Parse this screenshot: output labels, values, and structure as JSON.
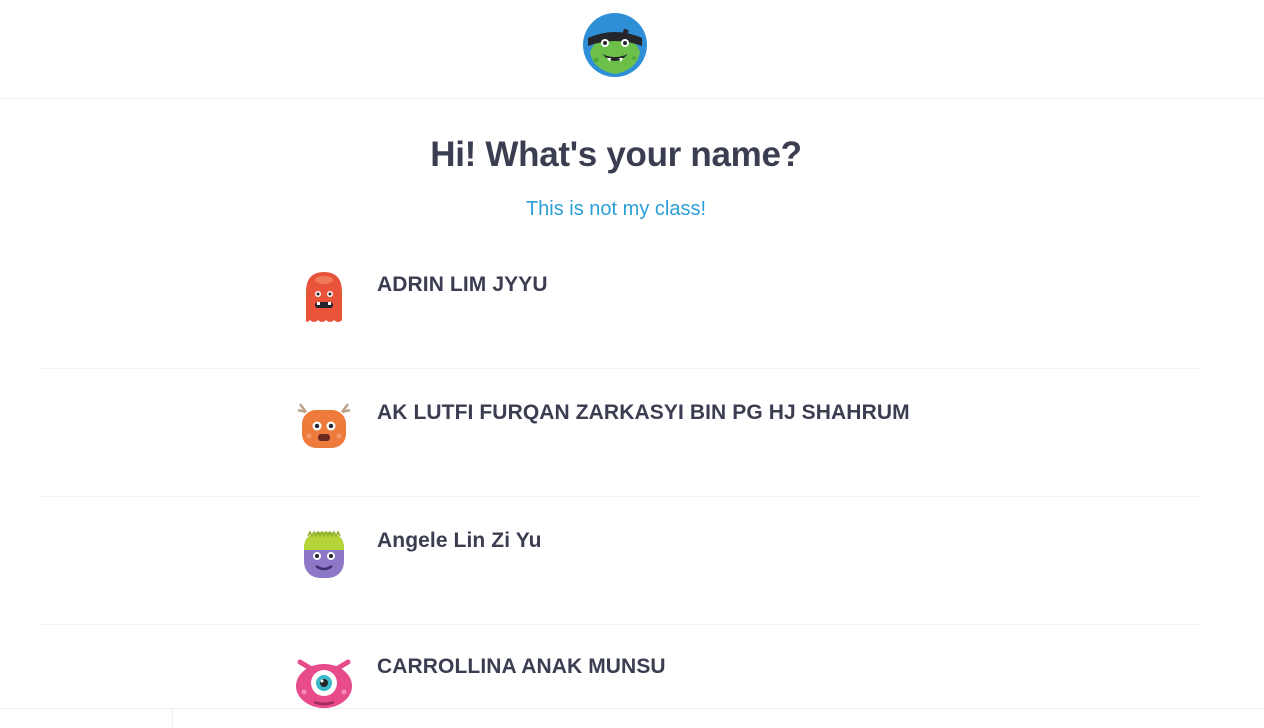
{
  "header": {
    "logo_icon": "classdojo-monster-logo-icon"
  },
  "main": {
    "title": "Hi! What's your name?",
    "not_my_class_link": "This is not my class!"
  },
  "students": [
    {
      "name": "ADRIN LIM JYYU",
      "avatar_icon": "red-monster-avatar-icon",
      "color": "#e8533a"
    },
    {
      "name": "AK LUTFI FURQAN ZARKASYI BIN PG HJ SHAHRUM",
      "avatar_icon": "orange-antler-monster-avatar-icon",
      "color": "#ee7a3b"
    },
    {
      "name": "Angele Lin Zi Yu",
      "avatar_icon": "purple-green-monster-avatar-icon",
      "color": "#8c78c7"
    },
    {
      "name": "CARROLLINA ANAK MUNSU",
      "avatar_icon": "pink-cyclops-monster-avatar-icon",
      "color": "#e84b8a"
    }
  ],
  "colors": {
    "heading": "#3b3d51",
    "link": "#2c9fd6"
  }
}
